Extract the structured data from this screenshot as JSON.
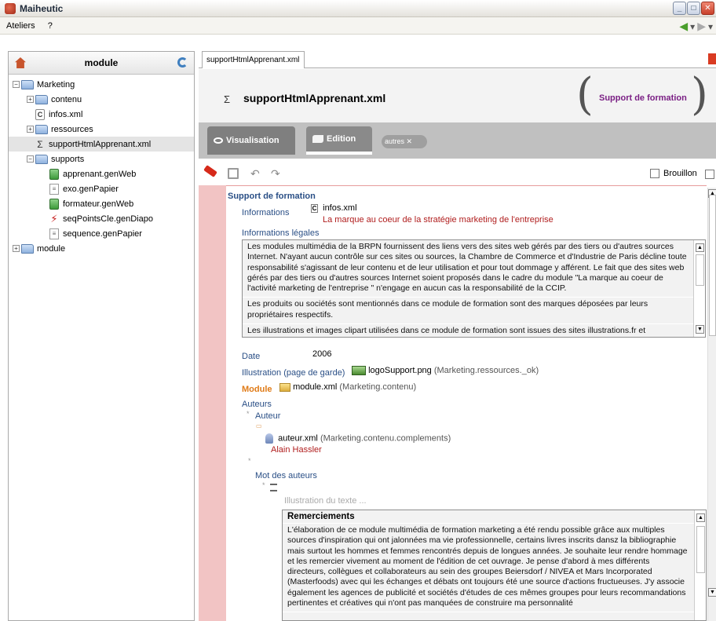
{
  "window": {
    "title": "Maiheutic"
  },
  "menu": {
    "items": [
      "Ateliers",
      "?"
    ]
  },
  "left_panel": {
    "title": "module",
    "tree": [
      {
        "label": "Marketing",
        "level": 0,
        "expand": "−",
        "kind": "folder-open"
      },
      {
        "label": "contenu",
        "level": 1,
        "expand": "+",
        "kind": "folder-open"
      },
      {
        "label": "infos.xml",
        "level": 1,
        "expand": "",
        "kind": "file-c"
      },
      {
        "label": "ressources",
        "level": 1,
        "expand": "+",
        "kind": "folder-open"
      },
      {
        "label": "supportHtmlApprenant.xml",
        "level": 1,
        "expand": "",
        "kind": "sigma",
        "selected": true
      },
      {
        "label": "supports",
        "level": 1,
        "expand": "−",
        "kind": "folder-open"
      },
      {
        "label": "apprenant.genWeb",
        "level": 2,
        "expand": "",
        "kind": "web"
      },
      {
        "label": "exo.genPapier",
        "level": 2,
        "expand": "",
        "kind": "paper"
      },
      {
        "label": "formateur.genWeb",
        "level": 2,
        "expand": "",
        "kind": "web"
      },
      {
        "label": "seqPointsCle.genDiapo",
        "level": 2,
        "expand": "",
        "kind": "pdf"
      },
      {
        "label": "sequence.genPapier",
        "level": 2,
        "expand": "",
        "kind": "paper"
      },
      {
        "label": "module",
        "level": 0,
        "expand": "+",
        "kind": "folder-open"
      }
    ]
  },
  "editor": {
    "tab_label": "supportHtmlApprenant.xml",
    "doc_title": "supportHtmlApprenant.xml",
    "doc_type": "Support de formation",
    "modes": {
      "visualisation": "Visualisation",
      "edition": "Edition",
      "autres": "autres"
    },
    "draft_label": "Brouillon",
    "section_title": "Support de formation",
    "informations_label": "Informations",
    "informations_file": "infos.xml",
    "informations_desc": "La marque au coeur de la stratégie marketing de l'entreprise",
    "infos_legales_label": "Informations légales",
    "infos_legales_paras": [
      "Les modules multimédia de la BRPN fournissent des liens vers des sites web gérés par des tiers ou d'autres sources Internet. N'ayant aucun contrôle sur ces sites ou sources, la Chambre de Commerce et d'Industrie de Paris décline toute responsabilité s'agissant de leur contenu et de leur utilisation et pour tout dommage y afférent. Le fait que des sites web gérés par des tiers ou d'autres sources Internet soient proposés dans le cadre du module \"La marque au coeur de l'activité marketing de l'entreprise \" n'engage en aucun cas la responsabilité de la CCIP.",
      "Les produits ou sociétés sont mentionnés dans ce module de formation sont des marques déposées par leurs propriétaires respectifs.",
      "Les illustrations et images clipart utilisées dans ce module de formation sont issues des sites illustrations.fr et microsoft.com et"
    ],
    "date_label": "Date",
    "date_value": "2006",
    "illustration_label": "Illustration (page de garde)",
    "illustration_file": "logoSupport.png",
    "illustration_path": "(Marketing.ressources._ok)",
    "module_label": "Module",
    "module_file": "module.xml",
    "module_path": "(Marketing.contenu)",
    "auteurs_label": "Auteurs",
    "auteur_label": "Auteur",
    "auteur_file": "auteur.xml",
    "auteur_path": "(Marketing.contenu.complements)",
    "auteur_name": "Alain Hassler",
    "mot_label": "Mot des auteurs",
    "illustration_placeholder": "Illustration du texte ...",
    "remerciements_title": "Remerciements",
    "remerciements_text": "L'élaboration de ce module multimédia de formation marketing a été rendu possible grâce aux multiples sources d'inspiration qui ont jalonnées ma vie professionnelle, certains livres inscrits dansz la bibliographie mais surtout les hommes et femmes rencontrés depuis de longues années. Je souhaite leur rendre hommage et les remercier vivement au moment de l'édition de cet ouvrage. Je pense d'abord à mes différents directeurs, collègues et collaborateurs au sein des groupes Beiersdorf / NIVEA et Mars Incorporated (Masterfoods) avec qui les échanges et débats ont toujours été une source d'actions fructueuses. J'y associe également les agences de publicité et sociétés d'études de ces mêmes groupes pour leurs recommandations pertinentes et créatives qui n'ont pas manquées de construire ma personnalité"
  }
}
